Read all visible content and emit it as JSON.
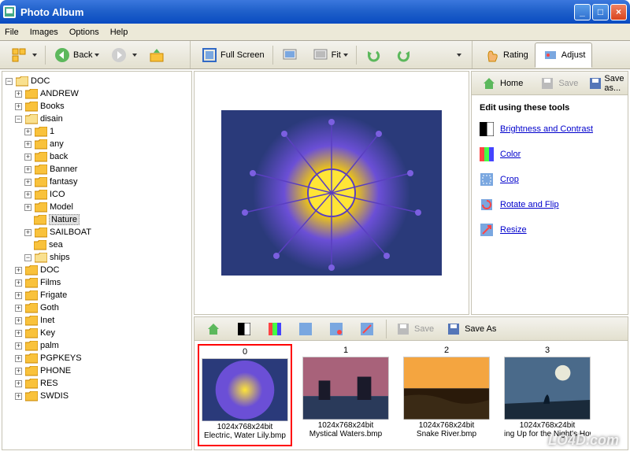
{
  "window": {
    "title": "Photo Album"
  },
  "menu": {
    "file": "File",
    "images": "Images",
    "options": "Options",
    "help": "Help"
  },
  "toolbar": {
    "back": "Back",
    "fullscreen": "Full Screen",
    "fit": "Fit"
  },
  "tabs": {
    "rating": "Rating",
    "adjust": "Adjust"
  },
  "tools_bar": {
    "home": "Home",
    "save": "Save",
    "saveas": "Save as..."
  },
  "tools": {
    "heading": "Edit using these tools",
    "brightness": "Brightness and Contrast",
    "color": "Color",
    "crop": "Crop",
    "rotate": "Rotate and Flip",
    "resize": "Resize"
  },
  "thumb_toolbar": {
    "save": "Save",
    "saveas": "Save As"
  },
  "tree": {
    "root": "DOC",
    "items1": [
      "ANDREW",
      "Books"
    ],
    "disain": "disain",
    "disain_items": [
      "1",
      "any",
      "back",
      "Banner",
      "fantasy",
      "ICO",
      "Model",
      "Nature",
      "SAILBOAT",
      "sea",
      "ships"
    ],
    "items2": [
      "DOC",
      "Films",
      "Frigate",
      "Goth",
      "Inet",
      "Key",
      "palm",
      "PGPKEYS",
      "PHONE",
      "RES",
      "SWDIS"
    ]
  },
  "thumbnails": [
    {
      "index": "0",
      "meta": "1024x768x24bit",
      "name": "Electric, Water Lily.bmp"
    },
    {
      "index": "1",
      "meta": "1024x768x24bit",
      "name": "Mystical Waters.bmp"
    },
    {
      "index": "2",
      "meta": "1024x768x24bit",
      "name": "Snake River.bmp"
    },
    {
      "index": "3",
      "meta": "1024x768x24bit",
      "name": "ing Up for the Night's Howl"
    }
  ],
  "watermark": "LO4D.com"
}
